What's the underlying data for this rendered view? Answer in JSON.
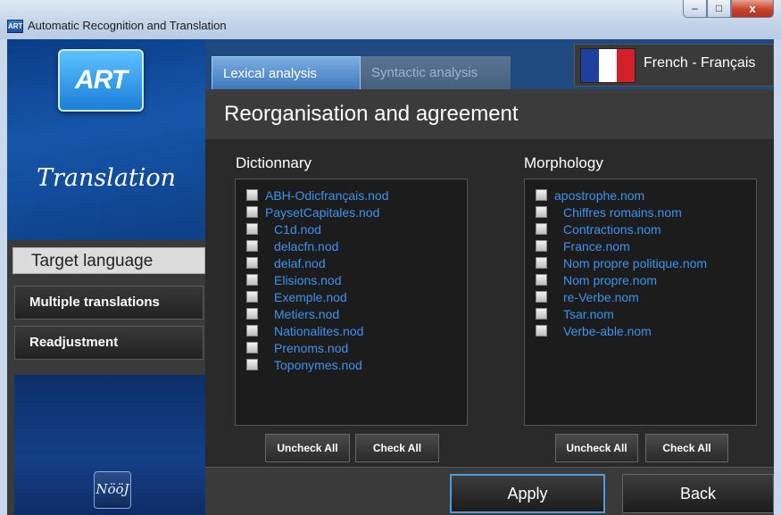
{
  "window": {
    "title": "Automatic Recognition and Translation",
    "app_icon_text": "ART",
    "controls": {
      "minimize": "‒",
      "maximize": "□",
      "close": "x"
    }
  },
  "sidebar": {
    "logo_text": "ART",
    "heading": "Translation",
    "items": [
      {
        "label": "Target language",
        "active": true
      },
      {
        "label": "Multiple translations",
        "active": false
      },
      {
        "label": "Readjustment",
        "active": false
      }
    ],
    "footer_logo_text": "NööJ"
  },
  "tabs": [
    {
      "label": "Lexical analysis",
      "selected": true
    },
    {
      "label": "Syntactic analysis",
      "selected": false
    }
  ],
  "language": {
    "label": "French - Français",
    "flag_colors": [
      "#1f3fa0",
      "#ffffff",
      "#d3202a"
    ]
  },
  "panel": {
    "title": "Reorganisation and agreement",
    "dictionary": {
      "title": "Dictionnary",
      "items": [
        "ABH-Odicfrançais.nod",
        "PaysetCapitales.nod",
        "C1d.nod",
        "delacfn.nod",
        "delaf.nod",
        "Elisions.nod",
        "Exemple.nod",
        "Metiers.nod",
        "Nationalites.nod",
        "Prenoms.nod",
        "Toponymes.nod"
      ],
      "uncheck_label": "Uncheck All",
      "check_label": "Check All"
    },
    "morphology": {
      "title": "Morphology",
      "items": [
        "apostrophe.nom",
        "Chiffres romains.nom",
        "Contractions.nom",
        "France.nom",
        "Nom propre politique.nom",
        "Nom propre.nom",
        "re-Verbe.nom",
        "Tsar.nom",
        "Verbe-able.nom"
      ],
      "uncheck_label": "Uncheck All",
      "check_label": "Check All"
    },
    "apply_label": "Apply",
    "back_label": "Back"
  },
  "colors": {
    "accent_blue": "#3c93ee",
    "panel_dark": "#2a2a2a",
    "sidebar_blue": "#1656aa"
  }
}
